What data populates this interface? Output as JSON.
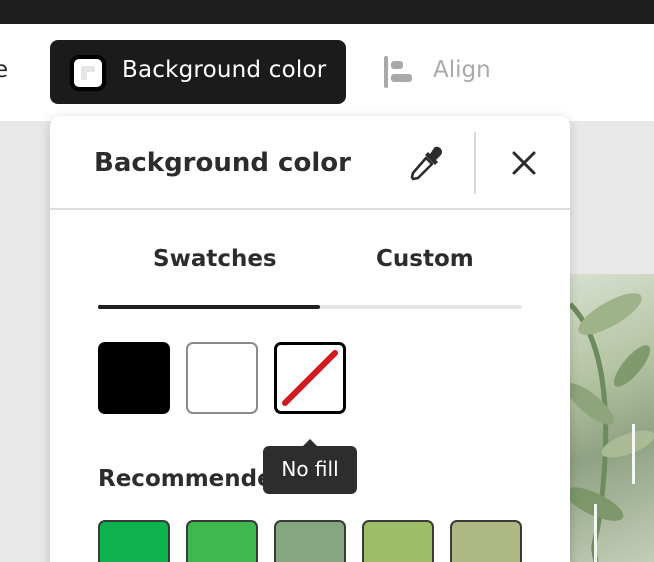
{
  "toolbar": {
    "prev_item_fragment": "e",
    "background_button_label": "Background color",
    "align_label": "Align"
  },
  "popover": {
    "title": "Background color",
    "tabs": [
      {
        "label": "Swatches",
        "active": true
      },
      {
        "label": "Custom",
        "active": false
      }
    ],
    "swatches": [
      {
        "name": "black",
        "color": "#000000"
      },
      {
        "name": "white",
        "color": "#ffffff"
      },
      {
        "name": "no-fill",
        "color": "none"
      }
    ],
    "tooltip": "No fill",
    "recommended_label": "Recommended",
    "recommended_swatches": [
      "#0db24c",
      "#3fb94f",
      "#84a77f",
      "#9dbd66",
      "#aeb882"
    ]
  },
  "icons": {
    "eyedropper": "eyedropper-icon",
    "close": "close-icon",
    "align": "align-left-icon",
    "background_swatch": "background-swatch-icon"
  },
  "colors": {
    "accent_dark": "#1b1b1b",
    "no_fill_slash": "#d0191e"
  }
}
